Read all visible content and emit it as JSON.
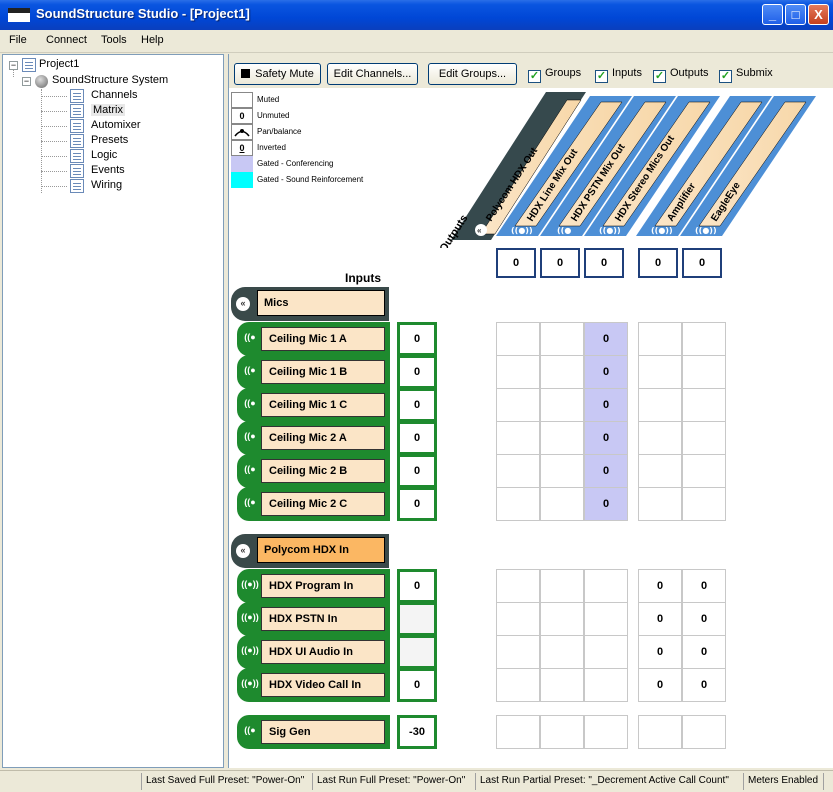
{
  "window": {
    "title": "SoundStructure Studio - [Project1]",
    "minimize": "_",
    "maximize": "□",
    "close": "X"
  },
  "menu": [
    "File",
    "Connect",
    "Tools",
    "Help"
  ],
  "tree": {
    "project": "Project1",
    "system": "SoundStructure System",
    "items": [
      "Channels",
      "Matrix",
      "Automixer",
      "Presets",
      "Logic",
      "Events",
      "Wiring"
    ],
    "selected": "Matrix"
  },
  "toolbar": {
    "safety_mute": "Safety Mute",
    "edit_channels": "Edit Channels...",
    "edit_groups": "Edit Groups...",
    "checkboxes": [
      {
        "label": "Groups",
        "checked": true
      },
      {
        "label": "Inputs",
        "checked": true
      },
      {
        "label": "Outputs",
        "checked": true
      },
      {
        "label": "Submix",
        "checked": true
      }
    ]
  },
  "legend": [
    {
      "symbol": "",
      "label": "Muted"
    },
    {
      "symbol": "0",
      "label": "Unmuted"
    },
    {
      "symbol": "",
      "label": "Pan/balance"
    },
    {
      "symbol": "0",
      "label": "Inverted"
    },
    {
      "symbol": "",
      "label": "Gated - Conferencing",
      "color": "#c8c8f4"
    },
    {
      "symbol": "",
      "label": "Gated - Sound Reinforcement",
      "color": "#00ffff"
    }
  ],
  "outputs_label": "Outputs",
  "inputs_label": "Inputs",
  "output_group": "Polycom HDX Out",
  "outputs": [
    {
      "name": "HDX Line Mix Out",
      "value": "0"
    },
    {
      "name": "HDX PSTN Mix Out",
      "value": "0"
    },
    {
      "name": "HDX Stereo Mics Out",
      "value": "0"
    },
    {
      "name": "Amplifier",
      "value": "0"
    },
    {
      "name": "EagleEye",
      "value": "0"
    }
  ],
  "groups": [
    {
      "name": "Mics",
      "channels": [
        {
          "name": "Ceiling Mic 1 A",
          "value": "0",
          "cells": [
            "",
            "",
            "0",
            "",
            ""
          ]
        },
        {
          "name": "Ceiling Mic 1 B",
          "value": "0",
          "cells": [
            "",
            "",
            "0",
            "",
            ""
          ]
        },
        {
          "name": "Ceiling Mic 1 C",
          "value": "0",
          "cells": [
            "",
            "",
            "0",
            "",
            ""
          ]
        },
        {
          "name": "Ceiling Mic 2 A",
          "value": "0",
          "cells": [
            "",
            "",
            "0",
            "",
            ""
          ]
        },
        {
          "name": "Ceiling Mic 2 B",
          "value": "0",
          "cells": [
            "",
            "",
            "0",
            "",
            ""
          ]
        },
        {
          "name": "Ceiling Mic 2 C",
          "value": "0",
          "cells": [
            "",
            "",
            "0",
            "",
            ""
          ]
        }
      ]
    },
    {
      "name": "Polycom HDX In",
      "channels": [
        {
          "name": "HDX Program In",
          "value": "0",
          "cells": [
            "",
            "",
            "",
            "0",
            "0"
          ]
        },
        {
          "name": "HDX PSTN In",
          "value": "",
          "cells": [
            "",
            "",
            "",
            "0",
            "0"
          ]
        },
        {
          "name": "HDX UI Audio In",
          "value": "",
          "cells": [
            "",
            "",
            "",
            "0",
            "0"
          ]
        },
        {
          "name": "HDX Video Call In",
          "value": "0",
          "cells": [
            "",
            "",
            "",
            "0",
            "0"
          ]
        }
      ]
    }
  ],
  "sig_gen": {
    "name": "Sig Gen",
    "value": "-30",
    "cells": [
      "",
      "",
      "",
      "",
      ""
    ]
  },
  "status": [
    "Last Saved Full Preset: \"Power-On\"",
    "Last Run Full Preset: \"Power-On\"",
    "Last Run Partial Preset: \"_Decrement Active Call Count\"",
    "Meters Enabled"
  ],
  "colors": {
    "conferencing": "#c8c8f4",
    "sound_reinforcement": "#00ffff",
    "input_channel": "#1e8a2e",
    "output_channel": "#4d8fd6"
  }
}
